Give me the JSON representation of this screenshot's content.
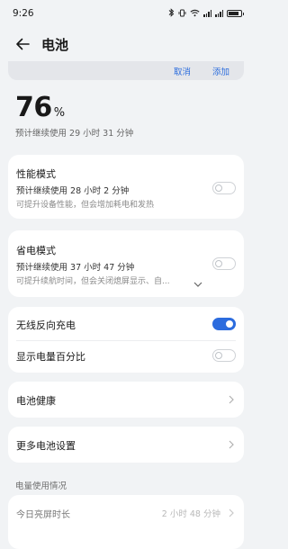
{
  "status_bar": {
    "time": "9:26"
  },
  "header": {
    "title": "电池"
  },
  "banner": {
    "cancel_label": "取消",
    "add_label": "添加"
  },
  "battery": {
    "level": "76",
    "unit": "%",
    "estimate": "预计继续使用 29 小时 31 分钟"
  },
  "performance_mode": {
    "title": "性能模式",
    "estimate": "预计继续使用 28 小时 2 分钟",
    "desc": "可提升设备性能，但会增加耗电和发热",
    "enabled": false
  },
  "power_saving_mode": {
    "title": "省电模式",
    "estimate": "预计继续使用 37 小时 47 分钟",
    "desc": "可提升续航时间，但会关闭熄屏显示、自...",
    "enabled": false
  },
  "toggles": {
    "wireless_reverse_charging": {
      "label": "无线反向充电",
      "enabled": true
    },
    "show_percentage": {
      "label": "显示电量百分比",
      "enabled": false
    }
  },
  "battery_health": {
    "label": "电池健康"
  },
  "more_settings": {
    "label": "更多电池设置"
  },
  "usage": {
    "section_title": "电量使用情况",
    "screen_on_label": "今日亮屏时长",
    "screen_on_value": "2 小时 48 分钟"
  },
  "colors": {
    "accent": "#2c6cde",
    "link": "#2f6fdd",
    "background": "#f1f3f5"
  }
}
